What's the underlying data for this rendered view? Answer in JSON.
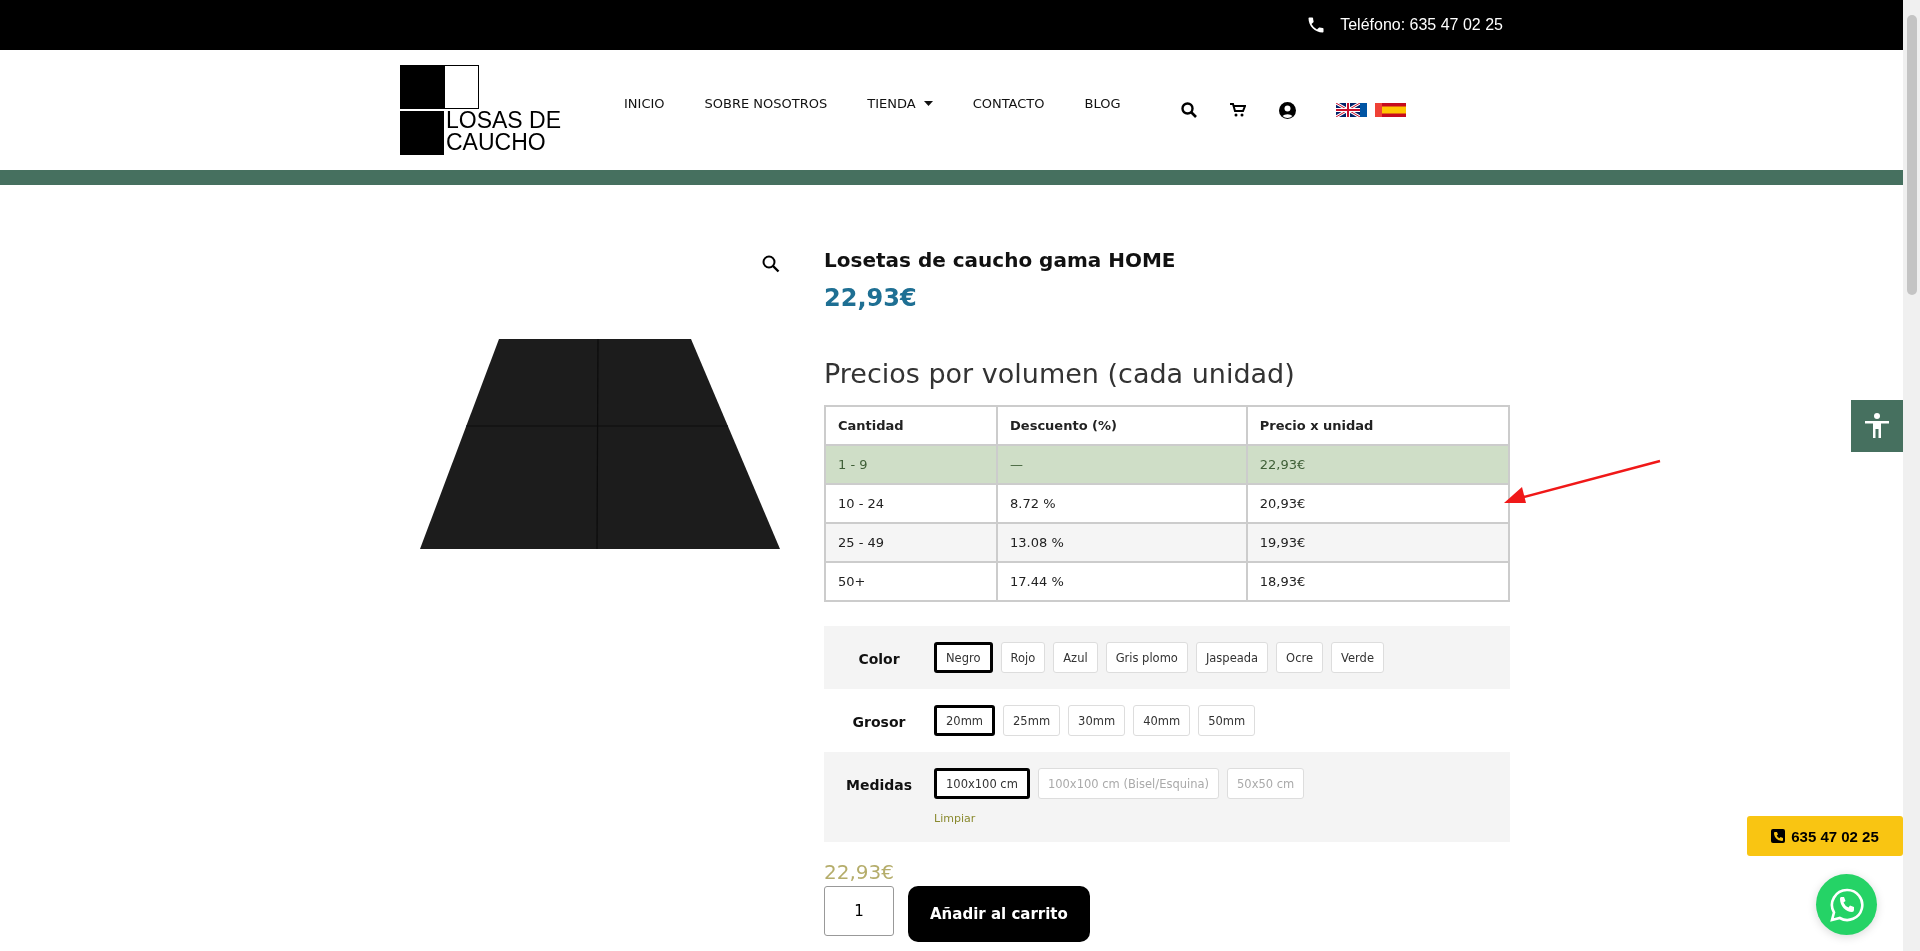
{
  "top_bar": {
    "phone": "Teléfono: 635 47 02 25"
  },
  "logo": {
    "line_1": "LOSAS DE",
    "line_2": "CAUCHO"
  },
  "nav": [
    {
      "label": "INICIO",
      "has_dropdown": false
    },
    {
      "label": "SOBRE NOSOTROS",
      "has_dropdown": false
    },
    {
      "label": "TIENDA",
      "has_dropdown": true
    },
    {
      "label": "CONTACTO",
      "has_dropdown": false
    },
    {
      "label": "BLOG",
      "has_dropdown": false
    }
  ],
  "product": {
    "title": "Losetas de caucho gama HOME",
    "price": "22,93€"
  },
  "volume_pricing": {
    "heading": "Precios por volumen (cada unidad)",
    "columns": [
      "Cantidad",
      "Descuento (%)",
      "Precio x unidad"
    ],
    "rows": [
      {
        "cells": [
          "1 - 9",
          "—",
          "22,93€"
        ],
        "selected": true
      },
      {
        "cells": [
          "10 - 24",
          "8.72 %",
          "20,93€"
        ],
        "selected": false
      },
      {
        "cells": [
          "25 - 49",
          "13.08 %",
          "19,93€"
        ],
        "selected": false
      },
      {
        "cells": [
          "50+",
          "17.44 %",
          "18,93€"
        ],
        "selected": false
      }
    ]
  },
  "attributes": [
    {
      "label": "Color",
      "options": [
        {
          "label": "Negro",
          "selected": true,
          "disabled": false
        },
        {
          "label": "Rojo",
          "selected": false,
          "disabled": false
        },
        {
          "label": "Azul",
          "selected": false,
          "disabled": false
        },
        {
          "label": "Gris plomo",
          "selected": false,
          "disabled": false
        },
        {
          "label": "Jaspeada",
          "selected": false,
          "disabled": false
        },
        {
          "label": "Ocre",
          "selected": false,
          "disabled": false
        },
        {
          "label": "Verde",
          "selected": false,
          "disabled": false
        }
      ]
    },
    {
      "label": "Grosor",
      "options": [
        {
          "label": "20mm",
          "selected": true,
          "disabled": false
        },
        {
          "label": "25mm",
          "selected": false,
          "disabled": false
        },
        {
          "label": "30mm",
          "selected": false,
          "disabled": false
        },
        {
          "label": "40mm",
          "selected": false,
          "disabled": false
        },
        {
          "label": "50mm",
          "selected": false,
          "disabled": false
        }
      ]
    },
    {
      "label": "Medidas",
      "options": [
        {
          "label": "100x100 cm",
          "selected": true,
          "disabled": false
        },
        {
          "label": "100x100 cm (Bisel/Esquina)",
          "selected": false,
          "disabled": true
        },
        {
          "label": "50x50 cm",
          "selected": false,
          "disabled": true
        }
      ],
      "clear_link": "Limpiar"
    }
  ],
  "variation_price": "22,93€",
  "quantity": "1",
  "add_to_cart": "Añadir al carrito",
  "floating_phone": "635 47 02 25"
}
